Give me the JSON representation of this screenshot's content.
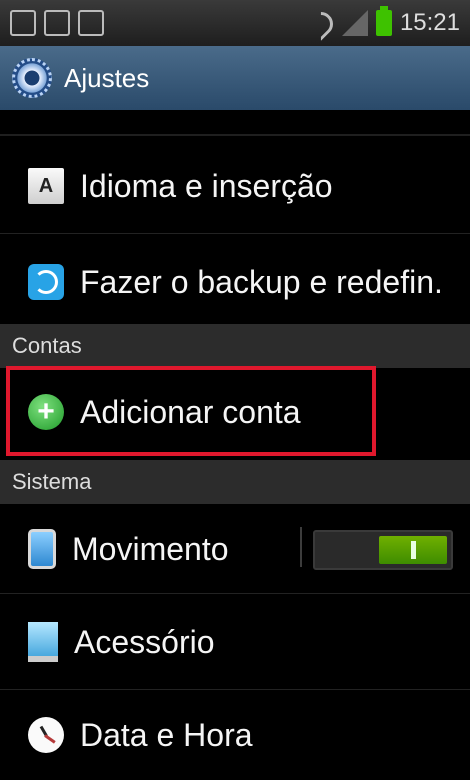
{
  "status_bar": {
    "time": "15:21"
  },
  "action_bar": {
    "title": "Ajustes",
    "icon": "settings-gear-icon"
  },
  "list": {
    "items": [
      {
        "label": "Idioma e inserção",
        "icon": "keyboard-a-icon"
      },
      {
        "label": "Fazer o backup e redefin.",
        "icon": "backup-reset-icon"
      }
    ],
    "headers": [
      {
        "label": "Contas"
      },
      {
        "label": "Sistema"
      }
    ],
    "accounts": [
      {
        "label": "Adicionar conta",
        "icon": "add-account-plus-icon"
      }
    ],
    "system": [
      {
        "label": "Movimento",
        "icon": "motion-phone-icon",
        "toggle_on": true
      },
      {
        "label": "Acessório",
        "icon": "accessory-device-icon"
      },
      {
        "label": "Data e Hora",
        "icon": "date-time-clock-icon"
      }
    ]
  },
  "colors": {
    "highlight_border": "#e0182d",
    "toggle_on": "#4f9f00"
  }
}
